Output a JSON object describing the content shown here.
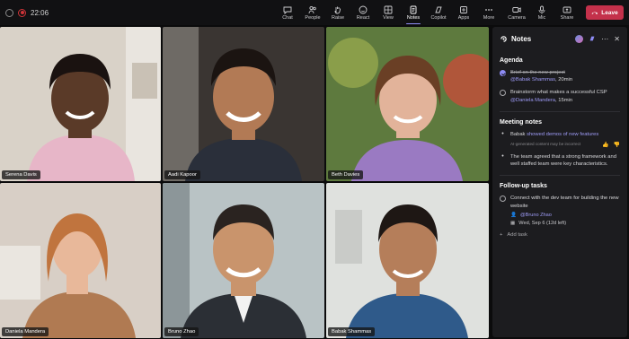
{
  "status": {
    "time": "22:06"
  },
  "toolbar": {
    "items": [
      {
        "label": "Chat",
        "icon": "chat-icon"
      },
      {
        "label": "People",
        "icon": "people-icon"
      },
      {
        "label": "Raise",
        "icon": "hand-icon"
      },
      {
        "label": "React",
        "icon": "smile-icon"
      },
      {
        "label": "View",
        "icon": "grid-icon"
      },
      {
        "label": "Notes",
        "icon": "notes-icon"
      },
      {
        "label": "Copilot",
        "icon": "copilot-icon"
      },
      {
        "label": "Apps",
        "icon": "apps-icon"
      },
      {
        "label": "More",
        "icon": "more-icon"
      }
    ],
    "devices": [
      {
        "label": "Camera",
        "icon": "camera-icon"
      },
      {
        "label": "Mic",
        "icon": "mic-icon"
      },
      {
        "label": "Share",
        "icon": "share-icon"
      }
    ],
    "leave_label": "Leave",
    "active": "Notes",
    "accent": "#8e8cf5",
    "leave_color": "#c4314b"
  },
  "participants": [
    {
      "name": "Serena Davis",
      "bg": "#d9d2c8",
      "skin": "#5a3a28",
      "hair": "#1a1210",
      "shirt": "#e7b6c8"
    },
    {
      "name": "Aadi Kapoor",
      "bg": "#3a3532",
      "skin": "#b27a55",
      "hair": "#1b1411",
      "shirt": "#2a2f3a"
    },
    {
      "name": "Beth Davies",
      "bg": "#5e7a3e",
      "skin": "#e2b39a",
      "hair": "#6a3f25",
      "shirt": "#9a7ac2"
    },
    {
      "name": "Daniela Mandera",
      "bg": "#d8cfc6",
      "skin": "#e8b89a",
      "hair": "#c0743e",
      "shirt": "#b07a52"
    },
    {
      "name": "Bruno Zhao",
      "bg": "#b9c3c5",
      "skin": "#c9946c",
      "hair": "#2a2320",
      "shirt": "#2b2f35"
    },
    {
      "name": "Babak Shammas",
      "bg": "#dfe1de",
      "skin": "#b57e5a",
      "hair": "#1e1714",
      "shirt": "#2f5a8a"
    }
  ],
  "notes": {
    "title": "Notes",
    "agenda_title": "Agenda",
    "agenda": [
      {
        "text": "Brief on the new project",
        "done": true,
        "mention": "@Babak Shammas",
        "time": ", 20min"
      },
      {
        "text": "Brainstorm what makes a successful CSP",
        "done": false,
        "mention": "@Daniela Mandera",
        "time": ", 15min"
      }
    ],
    "meeting_title": "Meeting notes",
    "meeting": [
      {
        "prefix": "Babak ",
        "highlight": "showed demos of new features",
        "ai_label": "AI-generated content may be incorrect"
      },
      {
        "text": "The team agreed that a strong framework and well staffed team were key characteristics."
      }
    ],
    "followup_title": "Follow-up tasks",
    "task": {
      "text": "Connect with the dev team for building the new website",
      "assignee": "@Bruno Zhao",
      "due": "Wed, Sep 6 (12d left)"
    },
    "add_task_label": "Add task"
  }
}
